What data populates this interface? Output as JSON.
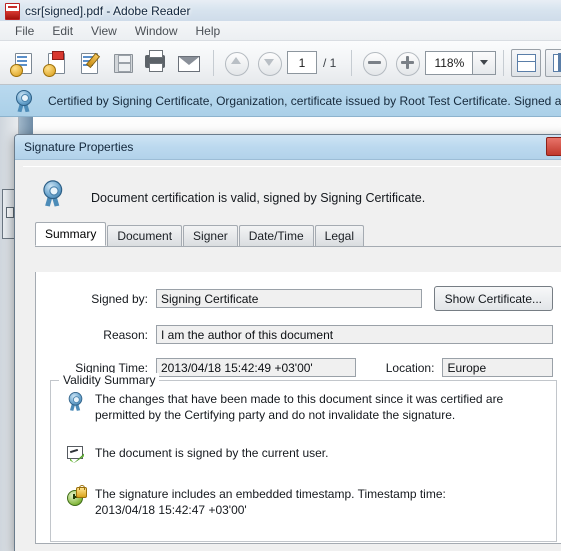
{
  "window": {
    "title": "csr[signed].pdf - Adobe Reader",
    "app_icon": "pdf-document-icon"
  },
  "menu": {
    "items": [
      "File",
      "Edit",
      "View",
      "Window",
      "Help"
    ]
  },
  "toolbar": {
    "buttons": [
      {
        "name": "open-file-icon"
      },
      {
        "name": "create-pdf-icon"
      },
      {
        "name": "sign-document-icon"
      },
      {
        "name": "save-file-icon"
      },
      {
        "name": "print-icon"
      },
      {
        "name": "email-icon"
      }
    ],
    "nav": {
      "previous_page_icon": "arrow-up-icon",
      "next_page_icon": "arrow-down-icon",
      "current_page": "1",
      "page_total": "/ 1"
    },
    "zoom": {
      "zoom_out_icon": "minus-circle-icon",
      "zoom_in_icon": "plus-circle-icon",
      "level": "118%",
      "dropdown_icon": "chevron-down-icon"
    },
    "right_buttons": [
      {
        "name": "fit-page-icon"
      },
      {
        "name": "fit-width-icon"
      }
    ]
  },
  "banner": {
    "icon": "blue-ribbon-seal-icon",
    "text": "Certified by Signing Certificate, Organization, certificate issued by Root Test Certificate. Signed and"
  },
  "dialog": {
    "title": "Signature Properties",
    "close_icon": "close-icon",
    "header": {
      "icon": "blue-ribbon-seal-icon",
      "text": "Document certification is valid, signed by Signing Certificate."
    },
    "tabs": [
      {
        "label": "Summary",
        "active": true
      },
      {
        "label": "Document",
        "active": false
      },
      {
        "label": "Signer",
        "active": false
      },
      {
        "label": "Date/Time",
        "active": false
      },
      {
        "label": "Legal",
        "active": false
      }
    ],
    "fields": {
      "signed_by_label": "Signed by:",
      "signed_by_value": "Signing Certificate",
      "show_certificate_button": "Show Certificate...",
      "reason_label": "Reason:",
      "reason_value": "I am the author of this document",
      "signing_time_label": "Signing Time:",
      "signing_time_value": "2013/04/18 15:42:49 +03'00'",
      "location_label": "Location:",
      "location_value": "Europe"
    },
    "validity": {
      "group_label": "Validity Summary",
      "items": [
        {
          "icon": "blue-ribbon-seal-icon",
          "line1": "The changes that have been made to this document since it was certified are",
          "line2": "permitted by the Certifying party and do not invalidate the signature."
        },
        {
          "icon": "green-signature-check-icon",
          "line1": "The document is signed by the current user.",
          "line2": ""
        },
        {
          "icon": "green-clock-lock-icon",
          "line1": "The signature includes an embedded timestamp. Timestamp time:",
          "line2": "2013/04/18 15:42:47 +03'00'"
        }
      ]
    }
  },
  "colors": {
    "banner_blue": "#b2d4ea",
    "dialog_title_blue": "#bcd9ef",
    "close_red": "#c0382c",
    "seal_blue": "#3f7fae",
    "check_green": "#5aa82d"
  }
}
